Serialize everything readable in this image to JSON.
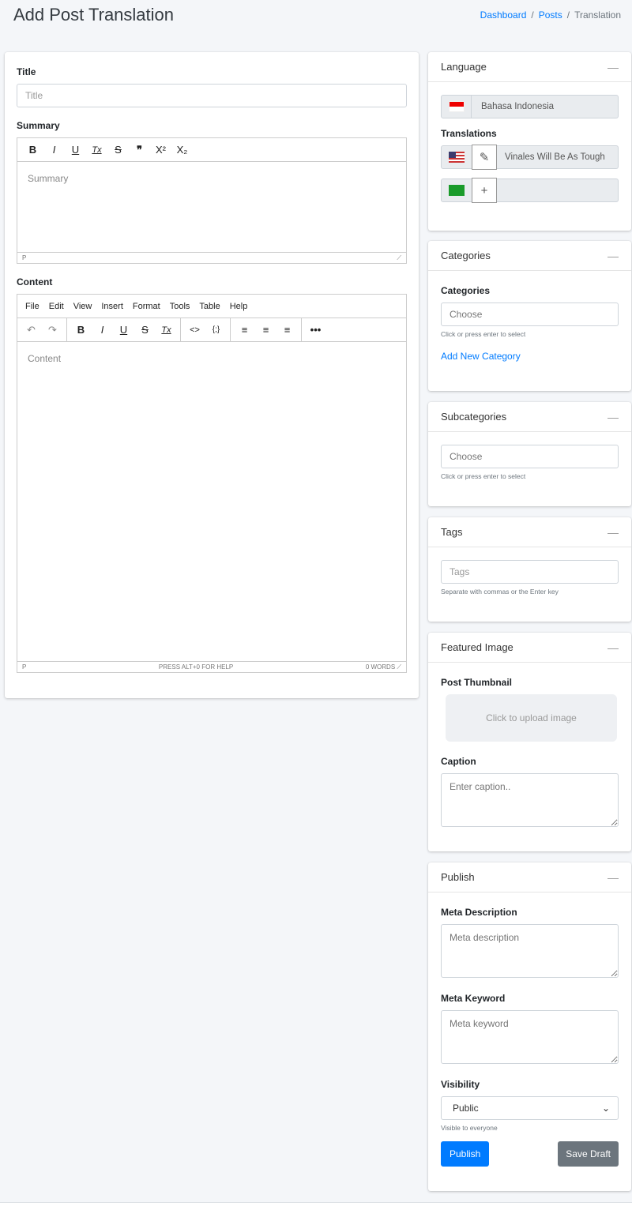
{
  "header": {
    "title": "Add Post Translation",
    "breadcrumb": [
      "Dashboard",
      "Posts",
      "Translation"
    ]
  },
  "main": {
    "title_label": "Title",
    "title_placeholder": "Title",
    "summary_label": "Summary",
    "summary_placeholder": "Summary",
    "summary_status": "P",
    "summary_toolbar": [
      "B",
      "I",
      "U",
      "Tx",
      "S",
      "❞",
      "X²",
      "X₂"
    ],
    "content_label": "Content",
    "content_placeholder": "Content",
    "menu": [
      "File",
      "Edit",
      "View",
      "Insert",
      "Format",
      "Tools",
      "Table",
      "Help"
    ],
    "content_status_path": "P",
    "content_status_help": "PRESS ALT+0 FOR HELP",
    "content_status_words": "0 WORDS"
  },
  "language": {
    "title": "Language",
    "current": "Bahasa Indonesia",
    "translations_label": "Translations",
    "translations": [
      {
        "flag": "us",
        "title": "Vinales Will Be As Tough",
        "action": "edit"
      },
      {
        "flag": "sa",
        "title": "",
        "action": "add"
      }
    ]
  },
  "categories": {
    "title": "Categories",
    "label": "Categories",
    "placeholder": "Choose",
    "help": "Click or press enter to select",
    "add_link": "Add New Category"
  },
  "subcategories": {
    "title": "Subcategories",
    "placeholder": "Choose",
    "help": "Click or press enter to select"
  },
  "tags": {
    "title": "Tags",
    "placeholder": "Tags",
    "help": "Separate with commas or the Enter key"
  },
  "featured": {
    "title": "Featured Image",
    "thumb_label": "Post Thumbnail",
    "upload": "Click to upload image",
    "caption_label": "Caption",
    "caption_placeholder": "Enter caption.."
  },
  "publish": {
    "title": "Publish",
    "meta_desc_label": "Meta Description",
    "meta_desc_placeholder": "Meta description",
    "meta_kw_label": "Meta Keyword",
    "meta_kw_placeholder": "Meta keyword",
    "visibility_label": "Visibility",
    "visibility_value": "Public",
    "visibility_help": "Visible to everyone",
    "publish_btn": "Publish",
    "draft_btn": "Save Draft"
  },
  "colors": {
    "accent": "#007bff",
    "secondary": "#6c757d",
    "background": "#f4f6f9"
  }
}
